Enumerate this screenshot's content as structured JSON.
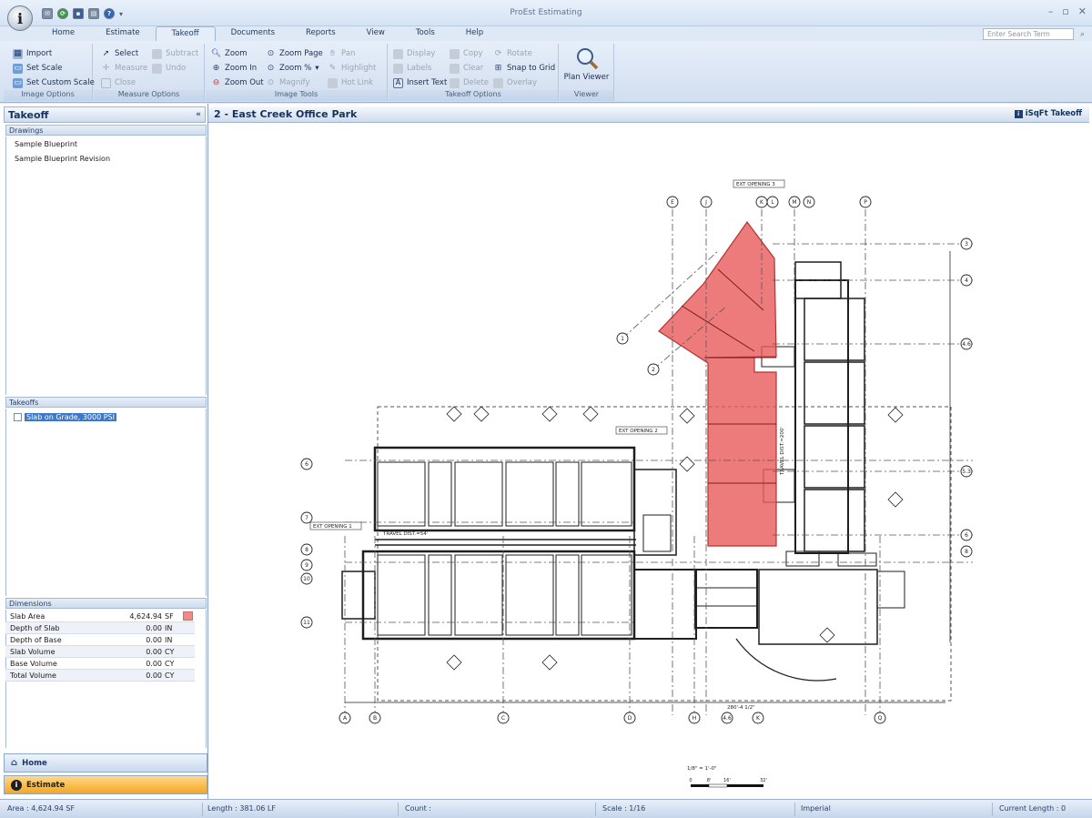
{
  "window": {
    "title": "ProEst Estimating"
  },
  "app_logo": "i",
  "ribbon_tabs": [
    "Home",
    "Estimate",
    "Takeoff",
    "Documents",
    "Reports",
    "View",
    "Tools",
    "Help"
  ],
  "active_tab": "Takeoff",
  "search": {
    "placeholder": "Enter Search Term"
  },
  "ribbon": {
    "image_options": {
      "label": "Image Options",
      "import": "Import",
      "set_scale": "Set Scale",
      "set_custom_scale": "Set Custom Scale"
    },
    "measure_options": {
      "label": "Measure Options",
      "select": "Select",
      "measure": "Measure",
      "close": "Close",
      "subtract": "Subtract",
      "undo": "Undo"
    },
    "image_tools": {
      "label": "Image Tools",
      "zoom": "Zoom",
      "zoom_in": "Zoom In",
      "zoom_out": "Zoom Out",
      "zoom_page": "Zoom Page",
      "zoom_pct": "Zoom %",
      "magnify": "Magnify",
      "pan": "Pan",
      "highlight": "Highlight",
      "hot_link": "Hot Link"
    },
    "takeoff_options": {
      "label": "Takeoff Options",
      "display": "Display",
      "labels": "Labels",
      "insert_text": "Insert Text",
      "copy": "Copy",
      "clear": "Clear",
      "delete": "Delete",
      "rotate": "Rotate",
      "snap_to_grid": "Snap to Grid",
      "overlay": "Overlay"
    },
    "viewer": {
      "label": "Viewer",
      "plan_viewer": "Plan Viewer"
    }
  },
  "left_panel": {
    "title": "Takeoff",
    "drawings_header": "Drawings",
    "drawings": [
      "Sample Blueprint",
      "Sample Blueprint Revision"
    ],
    "takeoffs_header": "Takeoffs",
    "takeoffs": [
      "Slab on Grade, 3000 PSI"
    ],
    "dimensions_header": "Dimensions",
    "dimensions": [
      {
        "name": "Slab Area",
        "value": "4,624.94",
        "unit": "SF"
      },
      {
        "name": "Depth of Slab",
        "value": "0.00",
        "unit": "IN"
      },
      {
        "name": "Depth of Base",
        "value": "0.00",
        "unit": "IN"
      },
      {
        "name": "Slab Volume",
        "value": "0.00",
        "unit": "CY"
      },
      {
        "name": "Base Volume",
        "value": "0.00",
        "unit": "CY"
      },
      {
        "name": "Total Volume",
        "value": "0.00",
        "unit": "CY"
      }
    ],
    "nav": {
      "home": "Home",
      "estimate": "Estimate"
    }
  },
  "main": {
    "title": "2 - East Creek Office Park",
    "isqft": "iSqFt Takeoff",
    "plan": {
      "ext_notes": [
        "EXT OPENING 3",
        "EXT OPENING 2",
        "EXT OPENING 1"
      ],
      "travel_note": "TRAVEL DIST.=54'",
      "travel_note2": "TRAVEL DIST.=200'",
      "dim_note": "280'-4 1/2\"",
      "scale_note": "1/8\" = 1'-0\"",
      "scale_ticks": [
        "0",
        "8'",
        "16'",
        "32'"
      ],
      "grid_top": [
        "E",
        "J",
        "K",
        "L",
        "M",
        "N",
        "P"
      ],
      "grid_right": [
        "3",
        "4",
        "4.6",
        "5.3",
        "6",
        "8"
      ],
      "grid_left": [
        "6",
        "7",
        "8",
        "9",
        "10",
        "11"
      ],
      "grid_diag": [
        "1",
        "2"
      ],
      "grid_bottom": [
        "A",
        "B",
        "C",
        "D",
        "H",
        "4.6",
        "K",
        "Q"
      ]
    },
    "highlight_color": "#e85a5a"
  },
  "status": {
    "area": "Area : 4,624.94 SF",
    "length": "Length : 381.06 LF",
    "count": "Count :",
    "scale": "Scale : 1/16",
    "units": "Imperial",
    "current_length": "Current Length : 0"
  }
}
